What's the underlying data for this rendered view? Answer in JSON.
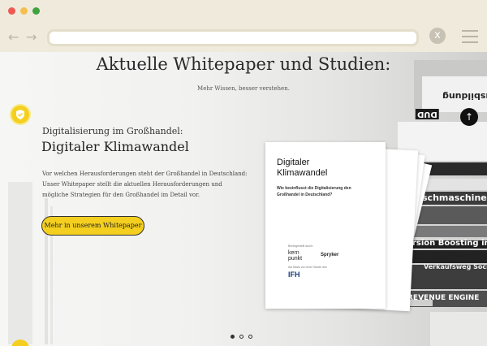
{
  "browser": {
    "colors": {
      "red": "#ee5a52",
      "yellow": "#f4bf4f",
      "green": "#3fa33f"
    },
    "back_icon": "arrow-left-icon",
    "forward_icon": "arrow-right-icon",
    "close_glyph": "x",
    "menu_icon": "hamburger-icon"
  },
  "hero": {
    "heading": "Aktuelle Whitepaper und Studien:",
    "subheading": "Mehr Wissen, besser verstehen.",
    "kicker": "Digitalisierung im Großhandel:",
    "title": "Digitaler Klimawandel",
    "body": "Vor welchen Herausforderungen steht der Großhandel in Deutschland: Unser Whitepaper stellt die aktuellen Herausforderungen und mögliche Strategien für den Großhandel im Detail vor.",
    "cta_label": "Mehr in unserem Whitepaper",
    "accent": "#f4cf1f"
  },
  "whitepaper": {
    "title_line1": "Digitaler",
    "title_line2": "Klimawandel",
    "subtitle": "Wie beeinflusst die Digitalisierung den Großhandel in Deutschland?",
    "byline": "Bereitgestellt durch:",
    "partner1": "kern punkt",
    "partner2": "Spryker",
    "study_note": "Auf Basis von einer Studie des",
    "study_logo": "IFH"
  },
  "books": {
    "spine1": "Ausbildung",
    "spine2": "DUD",
    "spine3": "schmaschinen",
    "spine4": "rsion Boosting im Webshop",
    "spine5": "Verkaufsweg Social Commerce",
    "spine6": "REVENUE ENGINE"
  },
  "carousel": {
    "count": 3,
    "active": 0
  }
}
